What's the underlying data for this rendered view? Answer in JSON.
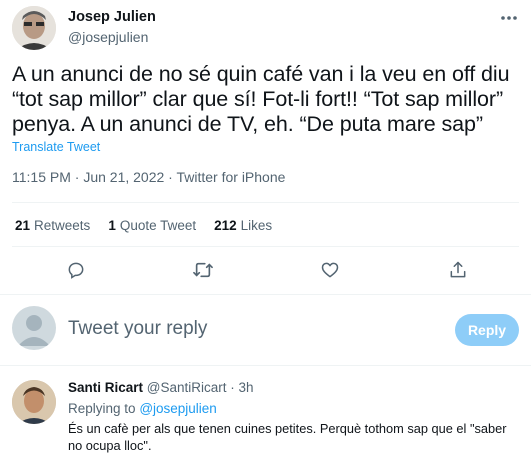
{
  "tweet": {
    "author_name": "Josep Julien",
    "author_handle": "@josepjulien",
    "text": "A un anunci de no sé quin café van i la veu en off diu “tot sap millor” clar que sí! Fot-li fort!! “Tot sap millor” penya. A un anunci de TV, eh. “De puta mare sap”",
    "translate_label": "Translate Tweet",
    "meta": "11:15 PM · Jun 21, 2022 · Twitter for iPhone",
    "stats": {
      "retweets_count": "21",
      "retweets_label": "Retweets",
      "quote_count": "1",
      "quote_label": "Quote Tweet",
      "likes_count": "212",
      "likes_label": "Likes"
    },
    "action_icons": [
      "reply-icon",
      "retweet-icon",
      "like-icon",
      "share-icon"
    ],
    "more_icon": "more-options-icon"
  },
  "reply_composer": {
    "placeholder": "Tweet your reply",
    "button_label": "Reply",
    "button_color": "#8ecdf8"
  },
  "reply": {
    "author_name": "Santi Ricart",
    "author_handle": "@SantiRicart",
    "time": "· 3h",
    "replying_prefix": "Replying to",
    "replying_to": "@josepjulien",
    "text": "És un cafè per als que tenen cuines petites. Perquè tothom sap que el \"saber no ocupa lloc\"."
  },
  "colors": {
    "accent": "#1d9bf0",
    "text_primary": "#0f1419",
    "text_secondary": "#536471",
    "divider": "#eff3f4"
  }
}
